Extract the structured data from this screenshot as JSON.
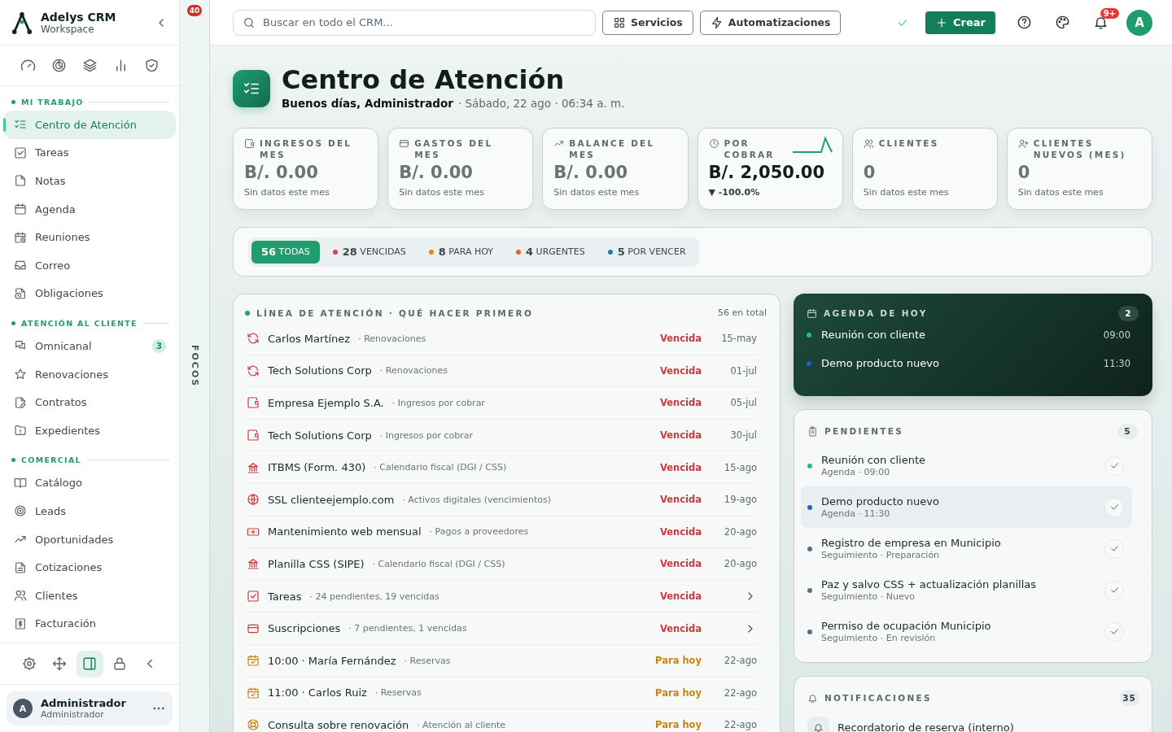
{
  "sidebar": {
    "brand": "Adelys CRM",
    "workspace": "Workspace",
    "sections": [
      {
        "title": "MI TRABAJO",
        "items": [
          {
            "label": "Centro de Atención",
            "selected": true
          },
          {
            "label": "Tareas",
            "selected": false
          },
          {
            "label": "Notas",
            "selected": false
          },
          {
            "label": "Agenda",
            "selected": false
          },
          {
            "label": "Reuniones",
            "selected": false
          },
          {
            "label": "Correo",
            "selected": false
          },
          {
            "label": "Obligaciones",
            "selected": false
          }
        ]
      },
      {
        "title": "ATENCIÓN AL CLIENTE",
        "items": [
          {
            "label": "Omnicanal",
            "selected": false,
            "badge": "3"
          },
          {
            "label": "Renovaciones",
            "selected": false
          },
          {
            "label": "Contratos",
            "selected": false
          },
          {
            "label": "Expedientes",
            "selected": false
          }
        ]
      },
      {
        "title": "COMERCIAL",
        "items": [
          {
            "label": "Catálogo",
            "selected": false
          },
          {
            "label": "Leads",
            "selected": false
          },
          {
            "label": "Oportunidades",
            "selected": false
          },
          {
            "label": "Cotizaciones",
            "selected": false
          },
          {
            "label": "Clientes",
            "selected": false
          },
          {
            "label": "Facturación",
            "selected": false
          }
        ]
      }
    ],
    "tools": [
      {
        "selected": false
      },
      {
        "selected": false
      },
      {
        "selected": true
      },
      {
        "selected": false
      },
      {
        "selected": false
      }
    ],
    "user": {
      "initial": "A",
      "name": "Administrador",
      "role": "Administrador"
    }
  },
  "focus_rail": {
    "badge": "40",
    "label": "FOCOS"
  },
  "topbar": {
    "search": {
      "placeholder": "Buscar en todo el CRM..."
    },
    "buttons": [
      "Servicios",
      "Automatizaciones"
    ],
    "create": "Crear",
    "notifications_badge": "9+",
    "avatar": "A"
  },
  "header": {
    "title": "Centro de Atención",
    "greeting": "Buenos días, Administrador",
    "date": "· Sábado, 22 ago · 06:34 a. m."
  },
  "metrics": [
    {
      "label": "INGRESOS DEL MES",
      "value": "B/. 0.00",
      "note": "Sin datos este mes",
      "kind": "empty"
    },
    {
      "label": "GASTOS DEL MES",
      "value": "B/. 0.00",
      "note": "Sin datos este mes",
      "kind": "empty"
    },
    {
      "label": "BALANCE DEL MES",
      "value": "B/. 0.00",
      "note": "Sin datos este mes",
      "kind": "empty"
    },
    {
      "label": "POR COBRAR",
      "value": "B/. 2,050.00",
      "note": "▼ -100.0%",
      "kind": "trend"
    },
    {
      "label": "CLIENTES",
      "value": "0",
      "note": "Sin datos este mes",
      "kind": "empty"
    },
    {
      "label": "CLIENTES NUEVOS (MES)",
      "value": "0",
      "note": "Sin datos este mes",
      "kind": "empty"
    }
  ],
  "filters": [
    {
      "count": "56",
      "label": "TODAS",
      "selected": true
    },
    {
      "count": "28",
      "label": "VENCIDAS",
      "selected": false,
      "color": "#d64545"
    },
    {
      "count": "8",
      "label": "PARA HOY",
      "selected": false,
      "color": "#d4900f"
    },
    {
      "count": "4",
      "label": "URGENTES",
      "selected": false,
      "color": "#e0681a"
    },
    {
      "count": "5",
      "label": "POR VENCER",
      "selected": false,
      "color": "#1b7fa8"
    }
  ],
  "attention": {
    "title": "LÍNEA DE ATENCIÓN · QUÉ HACER PRIMERO",
    "total": "56 en total",
    "rows": [
      {
        "title": "Carlos Martínez",
        "category": "· Renovaciones",
        "status": "Vencida",
        "kind": "overdue",
        "date": "15-may"
      },
      {
        "title": "Tech Solutions Corp",
        "category": "· Renovaciones",
        "status": "Vencida",
        "kind": "overdue",
        "date": "01-jul"
      },
      {
        "title": "Empresa Ejemplo S.A.",
        "category": "· Ingresos por cobrar",
        "status": "Vencida",
        "kind": "overdue",
        "date": "05-jul"
      },
      {
        "title": "Tech Solutions Corp",
        "category": "· Ingresos por cobrar",
        "status": "Vencida",
        "kind": "overdue",
        "date": "30-jul"
      },
      {
        "title": "ITBMS (Form. 430)",
        "category": "· Calendario fiscal (DGI / CSS)",
        "status": "Vencida",
        "kind": "overdue",
        "date": "15-ago"
      },
      {
        "title": "SSL clienteejemplo.com",
        "category": "· Activos digitales (vencimientos)",
        "status": "Vencida",
        "kind": "overdue",
        "date": "19-ago"
      },
      {
        "title": "Mantenimiento web mensual",
        "category": "· Pagos a proveedores",
        "status": "Vencida",
        "kind": "overdue",
        "date": "20-ago"
      },
      {
        "title": "Planilla CSS (SIPE)",
        "category": "· Calendario fiscal (DGI / CSS)",
        "status": "Vencida",
        "kind": "overdue",
        "date": "20-ago"
      },
      {
        "title": "Tareas",
        "category": "· 24 pendientes, 19 vencidas",
        "status": "Vencida",
        "kind": "overdue"
      },
      {
        "title": "Suscripciones",
        "category": "· 7 pendientes, 1 vencidas",
        "status": "Vencida",
        "kind": "overdue"
      },
      {
        "title": "10:00 · María Fernández",
        "category": "· Reservas",
        "status": "Para hoy",
        "kind": "today",
        "date": "22-ago"
      },
      {
        "title": "11:00 · Carlos Ruiz",
        "category": "· Reservas",
        "status": "Para hoy",
        "kind": "today",
        "date": "22-ago"
      },
      {
        "title": "Consulta sobre renovación",
        "category": "· Atención al cliente",
        "status": "Para hoy",
        "kind": "today",
        "date": "22-ago"
      }
    ]
  },
  "agenda": {
    "title": "AGENDA DE HOY",
    "count": "2",
    "items": [
      {
        "title": "Reunión con cliente",
        "time": "09:00",
        "color": "#1fbf7f"
      },
      {
        "title": "Demo producto nuevo",
        "time": "11:30",
        "color": "#2563c9"
      }
    ]
  },
  "pending": {
    "title": "PENDIENTES",
    "count": "5",
    "items": [
      {
        "title": "Reunión con cliente",
        "meta": "Agenda · 09:00",
        "color": "#1fbf7f",
        "selected": false
      },
      {
        "title": "Demo producto nuevo",
        "meta": "Agenda · 11:30",
        "color": "#2563c9",
        "selected": true
      },
      {
        "title": "Registro de empresa en Municipio",
        "meta": "Seguimiento · Preparación",
        "color": "#5b6b8c",
        "selected": false
      },
      {
        "title": "Paz y salvo CSS + actualización planillas",
        "meta": "Seguimiento · Nuevo",
        "color": "#5b6b8c",
        "selected": false
      },
      {
        "title": "Permiso de ocupación Municipio",
        "meta": "Seguimiento · En revisión",
        "color": "#5b6b8c",
        "selected": false
      }
    ]
  },
  "notifications": {
    "title": "NOTIFICACIONES",
    "count": "35",
    "items": [
      {
        "title": "Recordatorio de reserva (interno)"
      }
    ]
  }
}
